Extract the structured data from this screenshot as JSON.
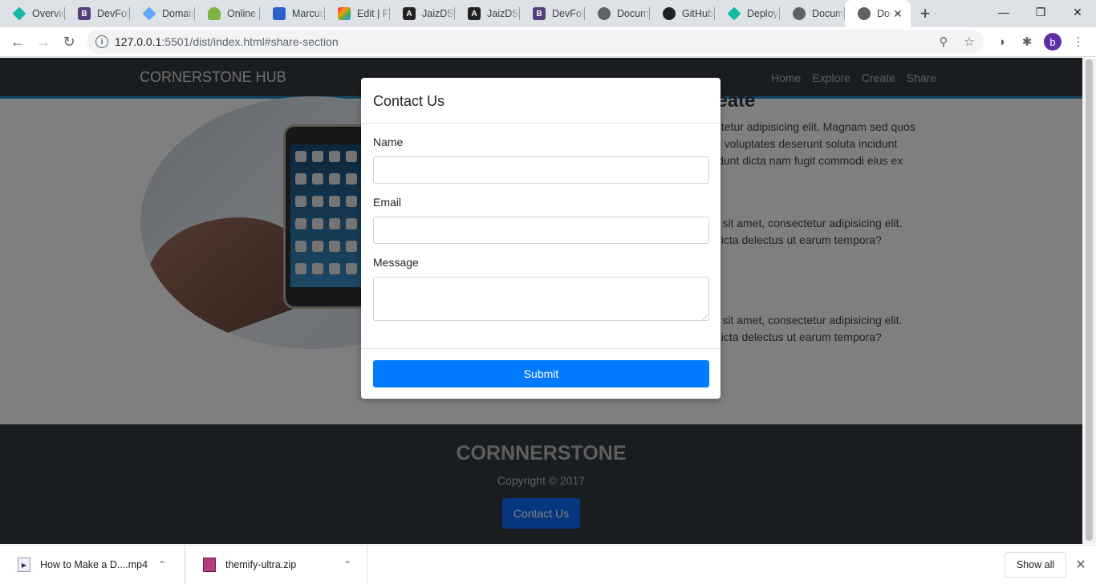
{
  "browser": {
    "tabs": [
      {
        "title": "Overvie",
        "icon": "diamond-teal-icon",
        "color": "#14b8a6"
      },
      {
        "title": "DevFoli",
        "icon": "bootstrap-icon",
        "color": "#563d7c"
      },
      {
        "title": "Domain",
        "icon": "diamond-blue-icon",
        "color": "#60a5fa"
      },
      {
        "title": "Online",
        "icon": "android-icon",
        "color": "#7cb342"
      },
      {
        "title": "Marcus",
        "icon": "hex-icon",
        "color": "#2a62c9"
      },
      {
        "title": "Edit | Fc",
        "icon": "colorgrid-icon",
        "color": "#e91e63"
      },
      {
        "title": "JaizDS",
        "icon": "angular-icon",
        "color": "#222222"
      },
      {
        "title": "JaizDS",
        "icon": "angular-icon",
        "color": "#222222"
      },
      {
        "title": "DevFoli",
        "icon": "bootstrap-icon",
        "color": "#563d7c"
      },
      {
        "title": "Docum",
        "icon": "globe-icon",
        "color": "#5f6368"
      },
      {
        "title": "GitHub",
        "icon": "github-icon",
        "color": "#202124"
      },
      {
        "title": "Deploy",
        "icon": "diamond-teal-icon",
        "color": "#14b8a6"
      },
      {
        "title": "Docum",
        "icon": "globe-icon",
        "color": "#5f6368"
      },
      {
        "title": "Doc",
        "icon": "globe-icon",
        "color": "#5f6368",
        "active": true
      }
    ],
    "new_tab_label": "+",
    "url_host": "127.0.0.1",
    "url_rest": ":5501/dist/index.html#share-section",
    "profile_initial": "b"
  },
  "site": {
    "brand": "CORNERSTONE HUB",
    "nav": [
      "Home",
      "Explore",
      "Create",
      "Share"
    ],
    "section_title_fragment": "reate",
    "paragraphs": [
      "ectetur adipisicing elit. Magnam sed quos\nus voluptates deserunt soluta incidunt\ncidunt dicta nam fugit commodi eius ex",
      "or sit amet, consectetur adipisicing elit.\ni dicta delectus ut earum tempora?",
      "or sit amet, consectetur adipisicing elit.\ni dicta delectus ut earum tempora?"
    ],
    "footer": {
      "title": "CORNNERSTONE",
      "copyright": "Copyright © 2017",
      "button": "Contact Us"
    }
  },
  "modal": {
    "title": "Contact Us",
    "fields": [
      {
        "label": "Name",
        "value": ""
      },
      {
        "label": "Email",
        "value": ""
      },
      {
        "label": "Message",
        "value": ""
      }
    ],
    "submit": "Submit"
  },
  "downloads": {
    "items": [
      {
        "name": "How to Make a D....mp4",
        "icon": "video-file-icon"
      },
      {
        "name": "themify-ultra.zip",
        "icon": "winrar-archive-icon"
      }
    ],
    "show_all": "Show all"
  }
}
